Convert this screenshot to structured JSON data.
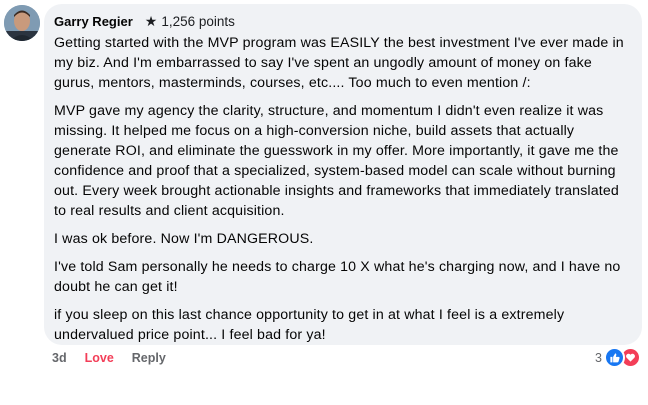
{
  "comment": {
    "author": "Garry Regier",
    "points": "1,256 points",
    "paragraphs": [
      "Getting started with the MVP program was EASILY the best investment I've ever made in my biz. And I'm embarrassed to say I've spent an ungodly amount of money on fake gurus, mentors, masterminds, courses, etc.... Too much to even mention /:",
      "MVP gave my agency the clarity, structure, and momentum I didn't even realize it was missing. It helped me focus on a high-conversion niche, build assets that actually generate ROI, and eliminate the guesswork in my offer. More importantly, it gave me the confidence and proof that a specialized, system-based model can scale without burning out. Every week brought actionable insights and frameworks that immediately translated to real results and client acquisition.",
      "I was ok before. Now I'm DANGEROUS.",
      "I've told Sam personally he needs to charge 10 X what he's charging now, and I have no doubt he can get it!",
      "if you sleep on this last chance opportunity to get in at what I feel is a extremely undervalued price point... I feel bad for ya!"
    ]
  },
  "actions": {
    "time": "3d",
    "love_label": "Love",
    "reply_label": "Reply"
  },
  "reactions": {
    "count": "3",
    "icons": [
      "like-icon",
      "love-icon"
    ],
    "like_color": "#1877f2",
    "love_color": "#f33e58"
  }
}
